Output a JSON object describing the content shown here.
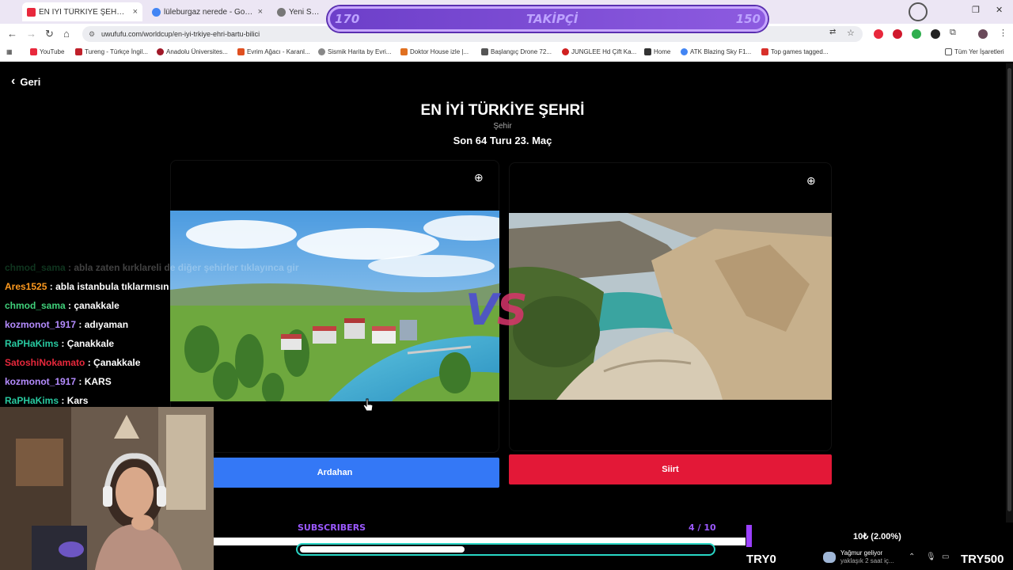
{
  "browser": {
    "tabs": [
      {
        "title": "EN İYİ TÜRKİYE ŞEHRİ | UwUFU..."
      },
      {
        "title": "lüleburgaz nerede - Google'da..."
      },
      {
        "title": "Yeni Sekme"
      }
    ],
    "url": "uwufufu.com/worldcup/en-iyi-trkiye-ehri-bartu-bilici",
    "bookmarks": [
      "YouTube",
      "Tureng - Türkçe İngil...",
      "Anadolu Üniversites...",
      "Evrim Ağacı - Karanl...",
      "Sismik Harita by Evri...",
      "Doktor House izle |...",
      "Başlangıç Drone 72...",
      "JUNGLEE Hd Çift Ka...",
      "Home",
      "ATK Blazing Sky F1...",
      "Top games tagged..."
    ],
    "all_bookmarks": "Tüm Yer İşaretleri"
  },
  "followers": {
    "current": "170",
    "label": "TAKİPÇİ",
    "goal": "150"
  },
  "page": {
    "back_label": "Geri",
    "title": "EN İYİ TÜRKİYE ŞEHRİ",
    "category": "Şehir",
    "round": "Son 64 Turu 23. Maç",
    "vs_v": "V",
    "vs_s": "S",
    "left_choice": "Ardahan",
    "right_choice": "Siirt"
  },
  "chat": [
    {
      "user": "chmod_sama",
      "msg": "abla zaten kırklareli de diğer şehirler tıklayınca gir",
      "color": "#3fd07a",
      "faded": true
    },
    {
      "user": "Ares1525",
      "msg": "abla istanbula tıklarmısın",
      "color": "#ff9a1f",
      "faded": false
    },
    {
      "user": "chmod_sama",
      "msg": "çanakkale",
      "color": "#3fd07a",
      "faded": false
    },
    {
      "user": "kozmonot_1917",
      "msg": "adıyaman",
      "color": "#b58cff",
      "faded": false
    },
    {
      "user": "RaPHaKims",
      "msg": "Çanakkale",
      "color": "#28c9a0",
      "faded": false
    },
    {
      "user": "SatoshiNokamato",
      "msg": "Çanakkale",
      "color": "#e8283c",
      "faded": false
    },
    {
      "user": "kozmonot_1917",
      "msg": "KARS",
      "color": "#b58cff",
      "faded": false
    },
    {
      "user": "RaPHaKims",
      "msg": "Kars",
      "color": "#28c9a0",
      "faded": false
    }
  ],
  "subs": {
    "label": "SUBSCRIBERS",
    "count": "4 / 10",
    "progress_fraction": 0.4
  },
  "tip": {
    "text": "10₺ (2.00%)",
    "min": "TRY0",
    "max": "TRY500"
  },
  "weather": {
    "line1": "Yağmur geliyor",
    "line2": "yaklaşık 2 saat iç..."
  },
  "colors": {
    "left_button": "#3478f6",
    "right_button": "#e31837",
    "accent_purple": "#9b59ff",
    "progress_border": "#29d6c5"
  }
}
